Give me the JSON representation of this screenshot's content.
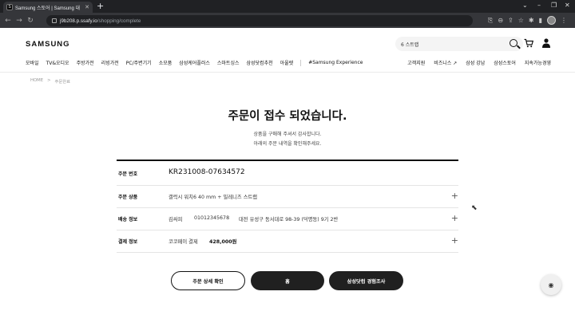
{
  "browser": {
    "tab_title": "Samsung 스토어 | Samsung 대",
    "favicon_letter": "S",
    "url_host": "j9b208.p.ssafy.io",
    "url_path": "/shopping/complete"
  },
  "header": {
    "logo": "SAMSUNG",
    "search_value": "6 스트랩",
    "nav": [
      "모바일",
      "TV&오디오",
      "주방가전",
      "리빙가전",
      "PC/주변기기",
      "소모품",
      "삼성케어플러스",
      "스마트싱스",
      "삼성닷컴추천",
      "아울렛"
    ],
    "nav_extra": "#Samsung Experience",
    "nav_right": [
      "고객지원",
      "비즈니스 ↗",
      "삼성 강남",
      "삼성스토어",
      "지속가능경영"
    ]
  },
  "breadcrumb": {
    "home": "HOME",
    "sep": ">",
    "current": "주문완료"
  },
  "main": {
    "title": "주문이 접수 되었습니다.",
    "subtitle1": "상품을 구매해 주셔서 감사합니다.",
    "subtitle2": "아래의 주문 내역을 확인해주세요."
  },
  "order": {
    "number_label": "주문 번호",
    "number_value": "KR231008-07634572",
    "product_label": "주문 상품",
    "product_value": "갤럭시 워치6 40 mm + 밀레니즈 스트랩",
    "delivery_label": "배송 정보",
    "delivery_name": "김싸피",
    "delivery_phone": "01012345678",
    "delivery_address": "대전 유성구 동서대로 98-39 (덕명동) 9기 2반",
    "payment_label": "결제 정보",
    "payment_method": "코코페이 결제",
    "payment_amount": "428,000원"
  },
  "buttons": {
    "detail": "주문 상세 확인",
    "home": "홈",
    "review": "삼성닷컴 경험조사"
  }
}
